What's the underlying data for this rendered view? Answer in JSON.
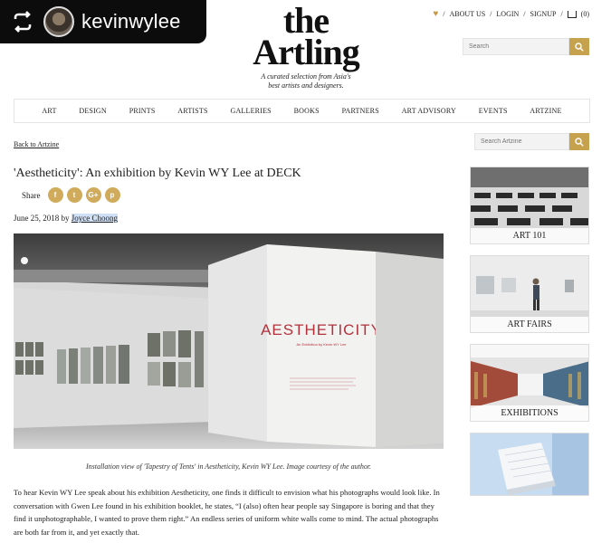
{
  "repost": {
    "username": "kevinwylee"
  },
  "logo": {
    "line1": "the",
    "line2": "Artling",
    "tagline_1": "A curated selection from Asia's",
    "tagline_2": "best artists and designers."
  },
  "toplinks": {
    "about": "ABOUT US",
    "login": "LOGIN",
    "signup": "SIGNUP",
    "cart_count": "(0)",
    "sep": "/"
  },
  "search": {
    "placeholder": "Search"
  },
  "nav": [
    "ART",
    "DESIGN",
    "PRINTS",
    "ARTISTS",
    "GALLERIES",
    "BOOKS",
    "PARTNERS",
    "ART ADVISORY",
    "EVENTS",
    "ARTZINE"
  ],
  "back_link": "Back to Artzine",
  "artzine_search": {
    "placeholder": "Search Artzine"
  },
  "article": {
    "title": "'Aestheticity': An exhibition by Kevin WY Lee at DECK",
    "share_label": "Share",
    "date": "June 25, 2018 by",
    "author": "Joyce Choong",
    "sign_text": "AESTHETICITY",
    "sign_sub": "An Exhibition by Kevin WY Lee",
    "caption": "Installation view of 'Tapestry of Tents' in Aestheticity, Kevin WY Lee. Image courtesy of the author.",
    "body": "To hear Kevin WY Lee speak about his exhibition Aestheticity, one finds it difficult to envision what his photographs would look like. In conversation with Gwen Lee found in his exhibition booklet, he states, “I (also) often hear people say Singapore is boring and that they find it unphotographable, I wanted to prove them right.” An endless series of uniform white walls come to mind. The actual photographs are both far from it, and yet exactly that."
  },
  "sidebar": {
    "tiles": [
      {
        "label": "ART 101"
      },
      {
        "label": "ART FAIRS"
      },
      {
        "label": "EXHIBITIONS"
      },
      {
        "label": ""
      }
    ]
  },
  "colors": {
    "accent": "#c6a24e",
    "share": "#d1ab5c",
    "sign_red": "#b3323c"
  }
}
